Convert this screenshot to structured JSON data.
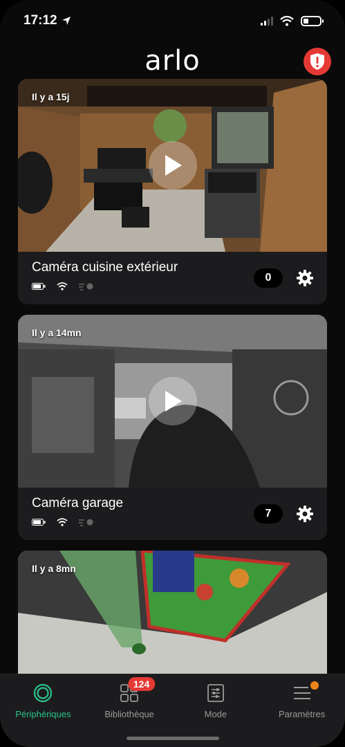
{
  "status": {
    "time": "17:12",
    "battery_level": 0.3
  },
  "header": {
    "logo": "arlo",
    "alert_icon": "shield-alert-icon",
    "alert_color": "#e53935"
  },
  "cameras": [
    {
      "time_ago": "Il y a 15j",
      "name": "Caméra cuisine extérieur",
      "count": "0"
    },
    {
      "time_ago": "Il y a 14mn",
      "name": "Caméra garage",
      "count": "7"
    },
    {
      "time_ago": "Il y a 8mn"
    }
  ],
  "tabs": [
    {
      "label": "Périphériques",
      "active": true,
      "icon": "devices-ring-icon"
    },
    {
      "label": "Bibliothèque",
      "badge": "124",
      "icon": "library-grid-icon"
    },
    {
      "label": "Mode",
      "icon": "mode-sliders-icon"
    },
    {
      "label": "Paramètres",
      "icon": "settings-menu-icon"
    }
  ],
  "colors": {
    "accent": "#2bc48a",
    "badge": "#e53935",
    "dot": "#f0851b"
  }
}
